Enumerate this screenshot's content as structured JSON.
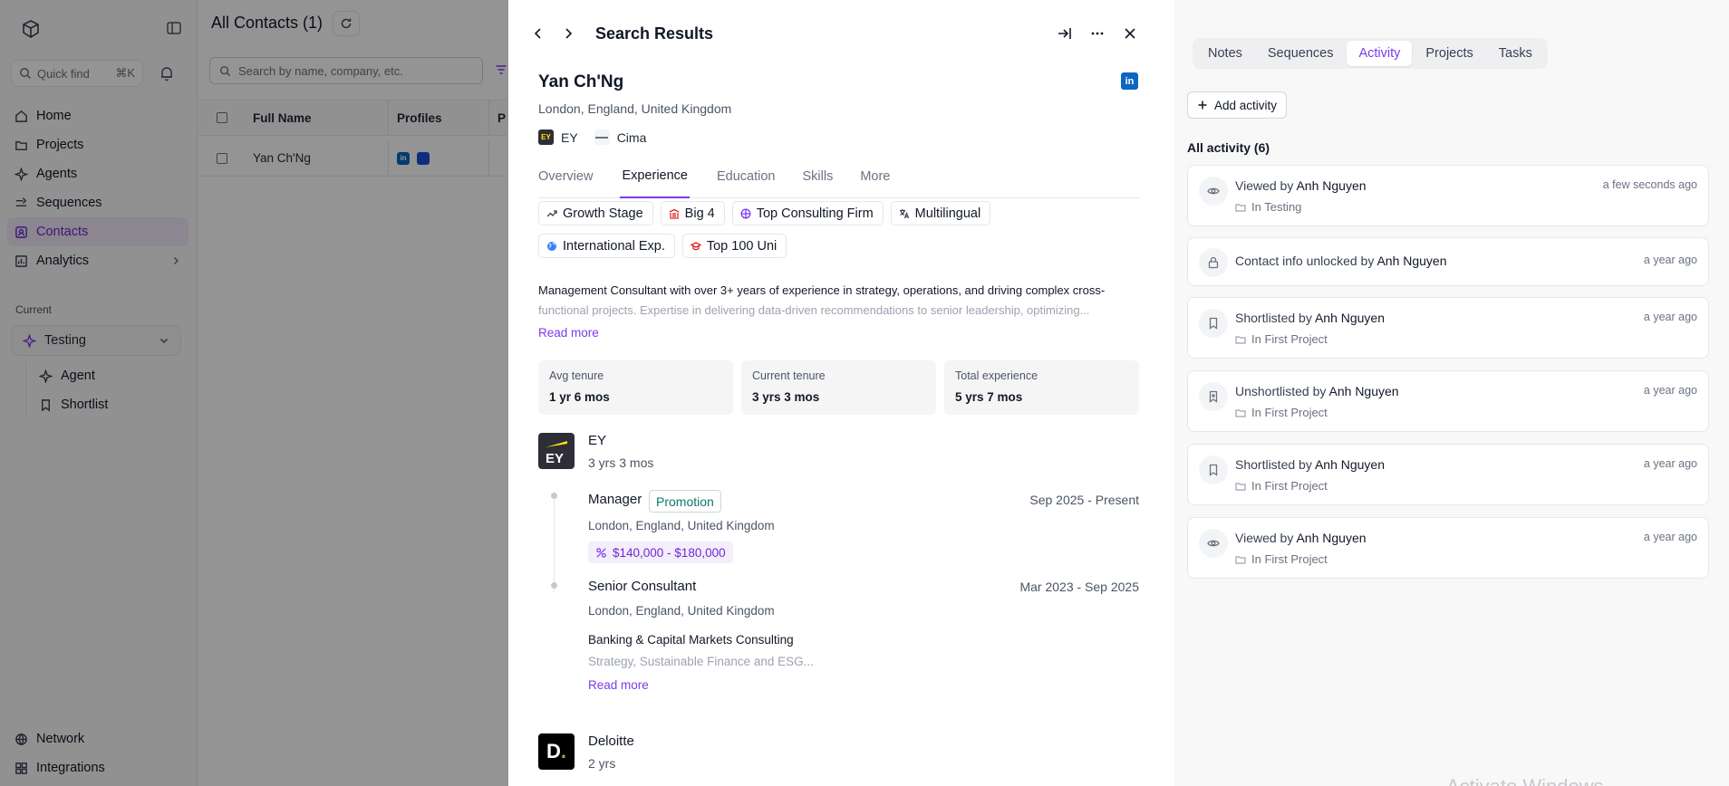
{
  "sidebar": {
    "quickfind_label": "Quick find",
    "quickfind_shortcut": "⌘K",
    "nav": [
      {
        "label": "Home",
        "icon": "home-icon"
      },
      {
        "label": "Projects",
        "icon": "folder-icon"
      },
      {
        "label": "Agents",
        "icon": "sparkle-icon"
      },
      {
        "label": "Sequences",
        "icon": "sequence-icon"
      },
      {
        "label": "Contacts",
        "icon": "contacts-icon",
        "active": true
      },
      {
        "label": "Analytics",
        "icon": "chart-icon"
      }
    ],
    "current_label": "Current",
    "current_project": "Testing",
    "subnav": [
      {
        "label": "Agent",
        "icon": "sparkle-icon"
      },
      {
        "label": "Shortlist",
        "icon": "bookmark-icon"
      }
    ],
    "bottom_nav": [
      {
        "label": "Network",
        "icon": "globe-icon"
      },
      {
        "label": "Integrations",
        "icon": "grid-icon"
      }
    ]
  },
  "contacts": {
    "title": "All Contacts (1)",
    "search_placeholder": "Search by name, company, etc.",
    "columns": [
      "Full Name",
      "Profiles",
      "P"
    ],
    "rows": [
      {
        "name": "Yan Ch'Ng"
      }
    ]
  },
  "panel": {
    "title": "Search Results",
    "name": "Yan Ch'Ng",
    "location": "London, England, United Kingdom",
    "companies": [
      "EY",
      "Cima"
    ],
    "tabs": [
      "Overview",
      "Experience",
      "Education",
      "Skills",
      "More"
    ],
    "active_tab": "Experience",
    "tags_row1": [
      "Growth Stage",
      "Big 4",
      "Top Consulting Firm",
      "Multilingual"
    ],
    "tags_row2": [
      "International Exp.",
      "Top 100 Uni"
    ],
    "summary_line1": "Management Consultant with over 3+ years of experience in strategy, operations, and driving complex cross-",
    "summary_line2": "functional projects. Expertise in delivering data-driven recommendations to senior leadership, optimizing...",
    "read_more": "Read more",
    "stats": [
      {
        "label": "Avg tenure",
        "value": "1 yr 6 mos"
      },
      {
        "label": "Current tenure",
        "value": "3 yrs 3 mos"
      },
      {
        "label": "Total experience",
        "value": "5 yrs 7 mos"
      }
    ],
    "experience": [
      {
        "company": "EY",
        "duration": "3 yrs 3 mos",
        "roles": [
          {
            "title": "Manager",
            "badge": "Promotion",
            "dates": "Sep 2025 - Present",
            "location": "London, England, United Kingdom",
            "salary": "$140,000 - $180,000"
          },
          {
            "title": "Senior Consultant",
            "dates": "Mar 2023 - Sep 2025",
            "location": "London, England, United Kingdom",
            "desc_title": "Banking & Capital Markets Consulting",
            "desc_sub": "Strategy, Sustainable Finance and ESG...",
            "read_more": "Read more"
          }
        ]
      },
      {
        "company": "Deloitte",
        "duration": "2 yrs"
      }
    ]
  },
  "activity": {
    "tabs": [
      "Notes",
      "Sequences",
      "Activity",
      "Projects",
      "Tasks"
    ],
    "active_tab": "Activity",
    "add_label": "Add activity",
    "all_label": "All activity (6)",
    "items": [
      {
        "icon": "eye-icon",
        "action": "Viewed by",
        "user": "Anh Nguyen",
        "time": "a few seconds ago",
        "sub": "In Testing"
      },
      {
        "icon": "lock-icon",
        "action": "Contact info unlocked by",
        "user": "Anh Nguyen",
        "time": "a year ago",
        "sub": ""
      },
      {
        "icon": "bookmark-icon",
        "action": "Shortlisted by",
        "user": "Anh Nguyen",
        "time": "a year ago",
        "sub": "In First Project"
      },
      {
        "icon": "bookmark-x-icon",
        "action": "Unshortlisted by",
        "user": "Anh Nguyen",
        "time": "a year ago",
        "sub": "In First Project"
      },
      {
        "icon": "bookmark-icon",
        "action": "Shortlisted by",
        "user": "Anh Nguyen",
        "time": "a year ago",
        "sub": "In First Project"
      },
      {
        "icon": "eye-icon",
        "action": "Viewed by",
        "user": "Anh Nguyen",
        "time": "a year ago",
        "sub": "In First Project"
      }
    ]
  },
  "watermark": "Activate Windows",
  "colors": {
    "accent": "#7c3aed",
    "linkedin": "#0a66c2",
    "overlay": "rgba(0,0,0,0.42)"
  }
}
